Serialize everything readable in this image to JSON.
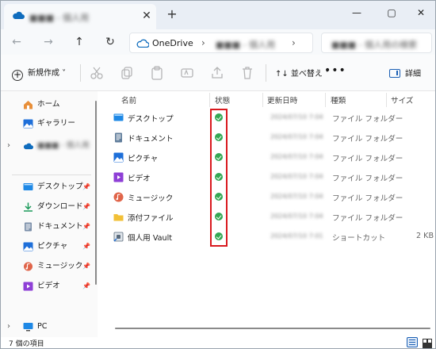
{
  "titlebar": {
    "tab_title": "■■■ - 個人用",
    "tab_close": "✕",
    "new_tab": "+",
    "minimize": "—",
    "maximize": "▢",
    "close": "✕"
  },
  "navbar": {
    "back": "←",
    "forward": "→",
    "up": "↑",
    "refresh": "↻",
    "breadcrumb": [
      "OneDrive",
      "■■■ - 個人用"
    ],
    "sep": "›",
    "search_placeholder": "■■■ - 個人用の検索"
  },
  "commandbar": {
    "new_label": "新規作成 ˅",
    "sort_label": "↑↓ 並べ替え ˅",
    "more": "•••",
    "details_label": "詳細"
  },
  "sidebar": {
    "items": [
      {
        "label": "ホーム",
        "icon": "home-icon"
      },
      {
        "label": "ギャラリー",
        "icon": "gallery-icon"
      },
      {
        "label": "■■■ - 個人用",
        "icon": "onedrive-icon"
      },
      {
        "label": "デスクトップ",
        "icon": "desktop-icon"
      },
      {
        "label": "ダウンロード",
        "icon": "download-icon"
      },
      {
        "label": "ドキュメント",
        "icon": "documents-icon"
      },
      {
        "label": "ピクチャ",
        "icon": "pictures-icon"
      },
      {
        "label": "ミュージック",
        "icon": "music-icon"
      },
      {
        "label": "ビデオ",
        "icon": "videos-icon"
      },
      {
        "label": "PC",
        "icon": "pc-icon"
      }
    ],
    "pin": "📌",
    "chevron": "›"
  },
  "columns": {
    "name": "名前",
    "status": "状態",
    "modified": "更新日時",
    "type": "種類",
    "size": "サイズ"
  },
  "files": [
    {
      "name": "デスクトップ",
      "date": "2024/07/10 7:04",
      "type": "ファイル フォルダー",
      "size": "",
      "icon": "desktop-folder-icon",
      "color": "#1e88e5"
    },
    {
      "name": "ドキュメント",
      "date": "2024/07/10 7:04",
      "type": "ファイル フォルダー",
      "size": "",
      "icon": "documents-folder-icon",
      "color": "#607d9b"
    },
    {
      "name": "ピクチャ",
      "date": "2024/07/10 7:04",
      "type": "ファイル フォルダー",
      "size": "",
      "icon": "pictures-folder-icon",
      "color": "#1e6fd9"
    },
    {
      "name": "ビデオ",
      "date": "2024/07/10 7:04",
      "type": "ファイル フォルダー",
      "size": "",
      "icon": "videos-folder-icon",
      "color": "#8e3fd6"
    },
    {
      "name": "ミュージック",
      "date": "2024/07/10 7:04",
      "type": "ファイル フォルダー",
      "size": "",
      "icon": "music-folder-icon",
      "color": "#e0654a"
    },
    {
      "name": "添付ファイル",
      "date": "2024/07/10 7:04",
      "type": "ファイル フォルダー",
      "size": "",
      "icon": "folder-icon",
      "color": "#f2c037"
    },
    {
      "name": "個人用 Vault",
      "date": "2024/07/10 7:01",
      "type": "ショートカット",
      "size": "2 KB",
      "icon": "vault-shortcut-icon",
      "color": "#5a6b7c"
    }
  ],
  "statusbar": {
    "item_count": "7 個の項目"
  },
  "colors": {
    "synced": "#34a853",
    "highlight": "#d9191e",
    "accent": "#1a5fb4",
    "onedrive": "#0f6cbd"
  }
}
